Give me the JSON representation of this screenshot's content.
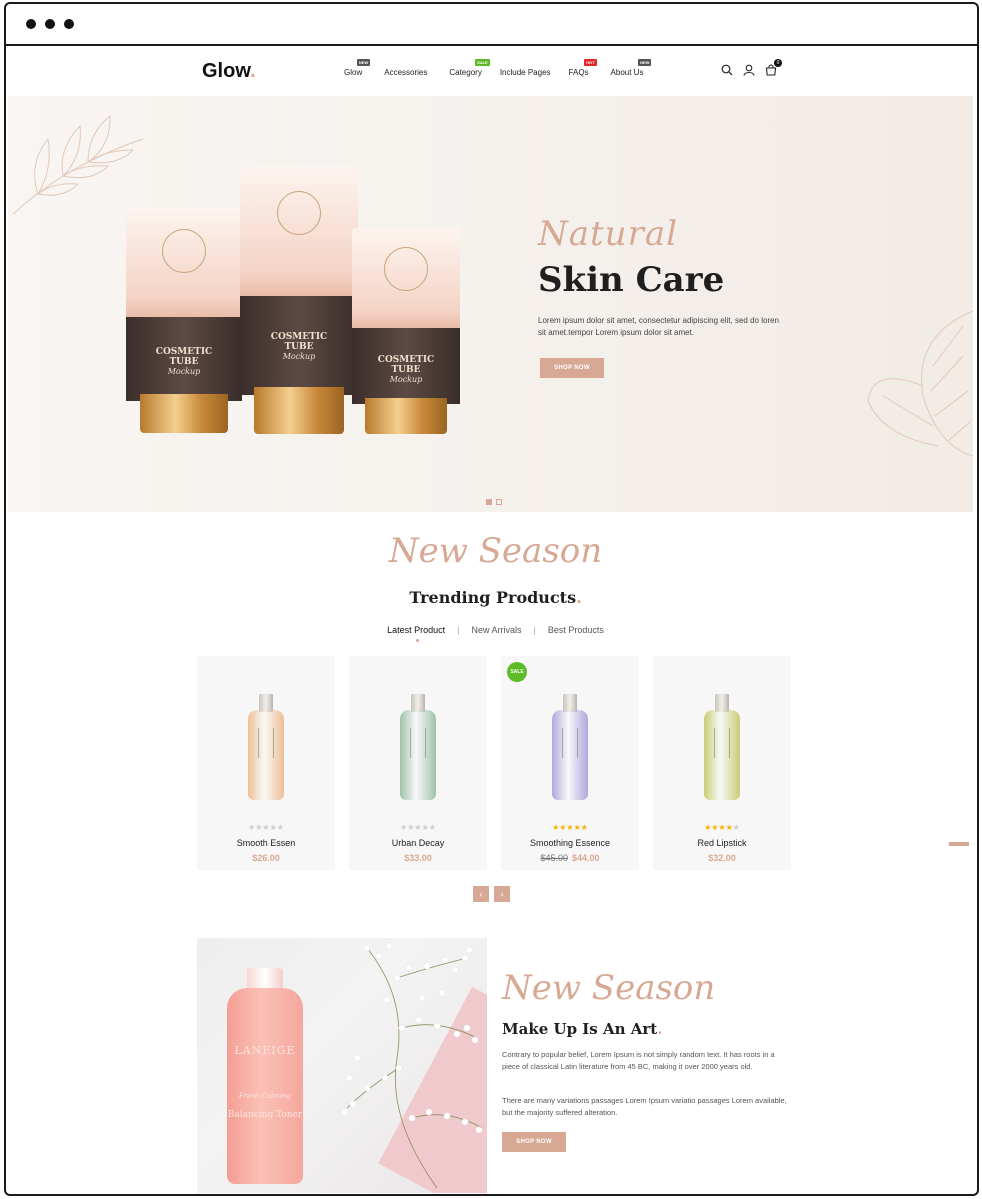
{
  "nav": {
    "logo": "Glow",
    "logo_dot": ".",
    "items": [
      {
        "label": "Glow",
        "badge": "NEW",
        "badge_color": "#555555"
      },
      {
        "label": "Accessories",
        "badge": "",
        "badge_color": ""
      },
      {
        "label": "Category",
        "badge": "SALE",
        "badge_color": "#5dbb2a"
      },
      {
        "label": "Include Pages",
        "badge": "",
        "badge_color": ""
      },
      {
        "label": "FAQs",
        "badge": "HOT",
        "badge_color": "#e52727"
      },
      {
        "label": "About Us",
        "badge": "NEW",
        "badge_color": "#555555"
      }
    ],
    "icons": [
      "search-icon",
      "user-icon",
      "cart-icon"
    ],
    "cart_count": "0"
  },
  "hero": {
    "script": "Natural",
    "title": "Skin Care",
    "text": "Lorem ipsum dolor sit amet, consectetur adipiscing elit, sed do loren sit amet.tempor Lorem ipsum dolor sit amet.",
    "button": "SHOP NOW",
    "tube_text": [
      "COSMETIC",
      "TUBE",
      "Mockup"
    ]
  },
  "trending": {
    "script": "New Season",
    "title": "Trending Products",
    "title_dot": ".",
    "tabs": [
      "Latest Product",
      "New Arrivals",
      "Best Products"
    ],
    "separator": "|",
    "products": [
      {
        "name": "Smooth Essen",
        "price": "$26.00",
        "old_price": "",
        "rating": 0,
        "sale": "",
        "color": "#eebf94"
      },
      {
        "name": "Urban Decay",
        "price": "$33.00",
        "old_price": "",
        "rating": 0,
        "sale": "",
        "color": "#9ec2aa"
      },
      {
        "name": "Smoothing Essence",
        "price": "$44.00",
        "old_price": "$45.00",
        "rating": 5,
        "sale": "SALE",
        "color": "#b1a8dc"
      },
      {
        "name": "Red Lipstick",
        "price": "$32.00",
        "old_price": "",
        "rating": 4,
        "sale": "",
        "color": "#c9cd72"
      }
    ],
    "prev": "‹",
    "next": "›"
  },
  "makeup": {
    "script": "New Season",
    "title": "Make Up Is An Art",
    "title_dot": ".",
    "p1": "Contrary to popular belief, Lorem Ipsum is not simply random text. It has roots in a piece of classical Latin literature from 45 BC, making it over 2000 years old.",
    "p2": "There are many variations passages Lorem Ipsum variatio passages Lorem available, but the majority suffered alteration.",
    "button": "SHOP NOW",
    "bottle_text": [
      "LANEIGE",
      "Fresh Calming",
      "Balancing Toner"
    ]
  },
  "colors": {
    "accent": "#d7a893",
    "star": "#f5b301",
    "star_off": "#cccccc"
  }
}
